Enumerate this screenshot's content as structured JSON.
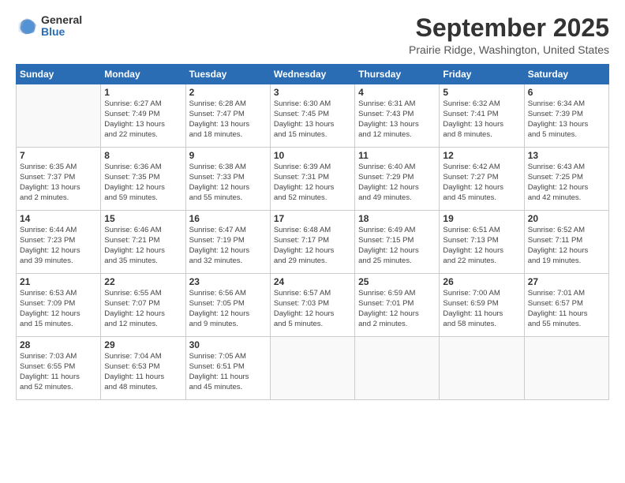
{
  "logo": {
    "general": "General",
    "blue": "Blue"
  },
  "title": "September 2025",
  "location": "Prairie Ridge, Washington, United States",
  "weekdays": [
    "Sunday",
    "Monday",
    "Tuesday",
    "Wednesday",
    "Thursday",
    "Friday",
    "Saturday"
  ],
  "weeks": [
    [
      {
        "day": "",
        "info": ""
      },
      {
        "day": "1",
        "info": "Sunrise: 6:27 AM\nSunset: 7:49 PM\nDaylight: 13 hours\nand 22 minutes."
      },
      {
        "day": "2",
        "info": "Sunrise: 6:28 AM\nSunset: 7:47 PM\nDaylight: 13 hours\nand 18 minutes."
      },
      {
        "day": "3",
        "info": "Sunrise: 6:30 AM\nSunset: 7:45 PM\nDaylight: 13 hours\nand 15 minutes."
      },
      {
        "day": "4",
        "info": "Sunrise: 6:31 AM\nSunset: 7:43 PM\nDaylight: 13 hours\nand 12 minutes."
      },
      {
        "day": "5",
        "info": "Sunrise: 6:32 AM\nSunset: 7:41 PM\nDaylight: 13 hours\nand 8 minutes."
      },
      {
        "day": "6",
        "info": "Sunrise: 6:34 AM\nSunset: 7:39 PM\nDaylight: 13 hours\nand 5 minutes."
      }
    ],
    [
      {
        "day": "7",
        "info": "Sunrise: 6:35 AM\nSunset: 7:37 PM\nDaylight: 13 hours\nand 2 minutes."
      },
      {
        "day": "8",
        "info": "Sunrise: 6:36 AM\nSunset: 7:35 PM\nDaylight: 12 hours\nand 59 minutes."
      },
      {
        "day": "9",
        "info": "Sunrise: 6:38 AM\nSunset: 7:33 PM\nDaylight: 12 hours\nand 55 minutes."
      },
      {
        "day": "10",
        "info": "Sunrise: 6:39 AM\nSunset: 7:31 PM\nDaylight: 12 hours\nand 52 minutes."
      },
      {
        "day": "11",
        "info": "Sunrise: 6:40 AM\nSunset: 7:29 PM\nDaylight: 12 hours\nand 49 minutes."
      },
      {
        "day": "12",
        "info": "Sunrise: 6:42 AM\nSunset: 7:27 PM\nDaylight: 12 hours\nand 45 minutes."
      },
      {
        "day": "13",
        "info": "Sunrise: 6:43 AM\nSunset: 7:25 PM\nDaylight: 12 hours\nand 42 minutes."
      }
    ],
    [
      {
        "day": "14",
        "info": "Sunrise: 6:44 AM\nSunset: 7:23 PM\nDaylight: 12 hours\nand 39 minutes."
      },
      {
        "day": "15",
        "info": "Sunrise: 6:46 AM\nSunset: 7:21 PM\nDaylight: 12 hours\nand 35 minutes."
      },
      {
        "day": "16",
        "info": "Sunrise: 6:47 AM\nSunset: 7:19 PM\nDaylight: 12 hours\nand 32 minutes."
      },
      {
        "day": "17",
        "info": "Sunrise: 6:48 AM\nSunset: 7:17 PM\nDaylight: 12 hours\nand 29 minutes."
      },
      {
        "day": "18",
        "info": "Sunrise: 6:49 AM\nSunset: 7:15 PM\nDaylight: 12 hours\nand 25 minutes."
      },
      {
        "day": "19",
        "info": "Sunrise: 6:51 AM\nSunset: 7:13 PM\nDaylight: 12 hours\nand 22 minutes."
      },
      {
        "day": "20",
        "info": "Sunrise: 6:52 AM\nSunset: 7:11 PM\nDaylight: 12 hours\nand 19 minutes."
      }
    ],
    [
      {
        "day": "21",
        "info": "Sunrise: 6:53 AM\nSunset: 7:09 PM\nDaylight: 12 hours\nand 15 minutes."
      },
      {
        "day": "22",
        "info": "Sunrise: 6:55 AM\nSunset: 7:07 PM\nDaylight: 12 hours\nand 12 minutes."
      },
      {
        "day": "23",
        "info": "Sunrise: 6:56 AM\nSunset: 7:05 PM\nDaylight: 12 hours\nand 9 minutes."
      },
      {
        "day": "24",
        "info": "Sunrise: 6:57 AM\nSunset: 7:03 PM\nDaylight: 12 hours\nand 5 minutes."
      },
      {
        "day": "25",
        "info": "Sunrise: 6:59 AM\nSunset: 7:01 PM\nDaylight: 12 hours\nand 2 minutes."
      },
      {
        "day": "26",
        "info": "Sunrise: 7:00 AM\nSunset: 6:59 PM\nDaylight: 11 hours\nand 58 minutes."
      },
      {
        "day": "27",
        "info": "Sunrise: 7:01 AM\nSunset: 6:57 PM\nDaylight: 11 hours\nand 55 minutes."
      }
    ],
    [
      {
        "day": "28",
        "info": "Sunrise: 7:03 AM\nSunset: 6:55 PM\nDaylight: 11 hours\nand 52 minutes."
      },
      {
        "day": "29",
        "info": "Sunrise: 7:04 AM\nSunset: 6:53 PM\nDaylight: 11 hours\nand 48 minutes."
      },
      {
        "day": "30",
        "info": "Sunrise: 7:05 AM\nSunset: 6:51 PM\nDaylight: 11 hours\nand 45 minutes."
      },
      {
        "day": "",
        "info": ""
      },
      {
        "day": "",
        "info": ""
      },
      {
        "day": "",
        "info": ""
      },
      {
        "day": "",
        "info": ""
      }
    ]
  ]
}
